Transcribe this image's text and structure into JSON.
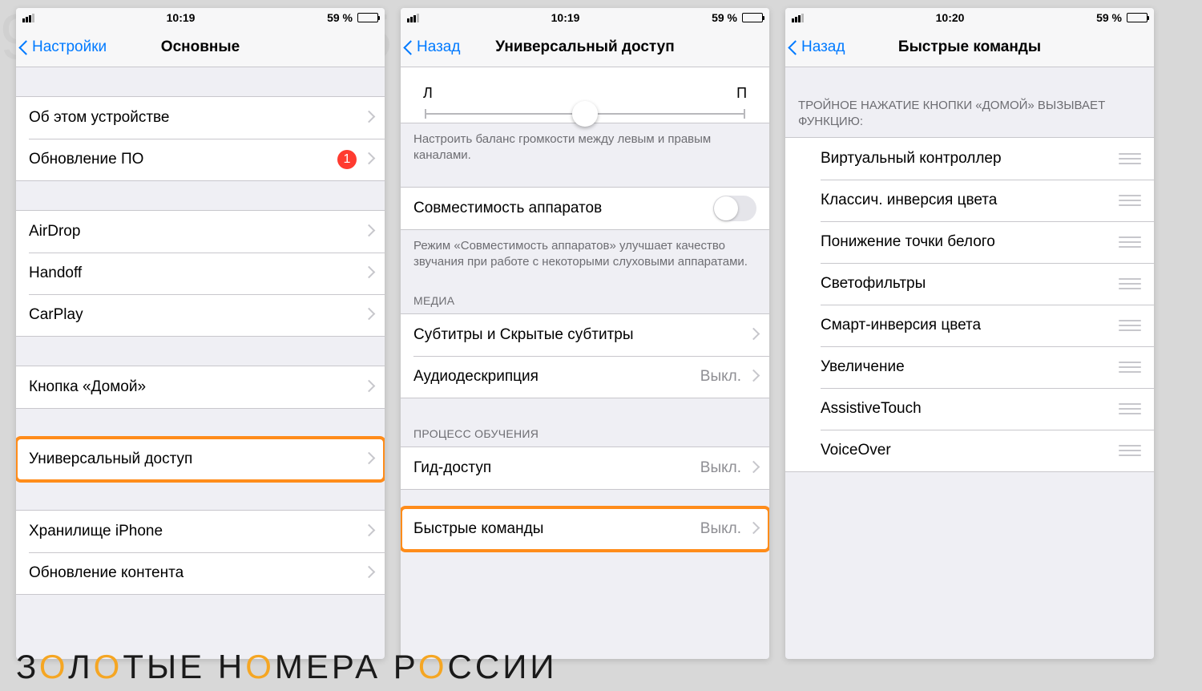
{
  "status": {
    "battery": "59 %"
  },
  "screen1": {
    "time": "10:19",
    "back": "Настройки",
    "title": "Основные",
    "g1": {
      "about": "Об этом устройстве",
      "update": "Обновление ПО",
      "badge": "1"
    },
    "g2": {
      "airdrop": "AirDrop",
      "handoff": "Handoff",
      "carplay": "CarPlay"
    },
    "g3": {
      "home": "Кнопка «Домой»"
    },
    "g4": {
      "access": "Универсальный доступ"
    },
    "g5": {
      "storage": "Хранилище iPhone",
      "refresh": "Обновление контента"
    }
  },
  "screen2": {
    "time": "10:19",
    "back": "Назад",
    "title": "Универсальный доступ",
    "slider": {
      "left": "Л",
      "right": "П"
    },
    "slider_footer": "Настроить баланс громкости между левым и правым каналами.",
    "compat": "Совместимость аппаратов",
    "compat_footer": "Режим «Совместимость аппаратов» улучшает качество звучания при работе с некоторыми слуховыми аппаратами.",
    "media_header": "МЕДИА",
    "subtitles": "Субтитры и Скрытые субтитры",
    "audiodesc": "Аудиодескрипция",
    "audiodesc_val": "Выкл.",
    "learn_header": "ПРОЦЕСС ОБУЧЕНИЯ",
    "guided": "Гид-доступ",
    "guided_val": "Выкл.",
    "shortcuts": "Быстрые команды",
    "shortcuts_val": "Выкл."
  },
  "screen3": {
    "time": "10:20",
    "back": "Назад",
    "title": "Быстрые команды",
    "header": "ТРОЙНОЕ НАЖАТИЕ КНОПКИ «ДОМОЙ» ВЫЗЫВАЕТ ФУНКЦИЮ:",
    "items": [
      "Виртуальный контроллер",
      "Классич. инверсия цвета",
      "Понижение точки белого",
      "Светофильтры",
      "Смарт-инверсия цвета",
      "Увеличение",
      "AssistiveTouch",
      "VoiceOver"
    ]
  },
  "watermark": {
    "t1": "З",
    "t2": "Л",
    "t3": "ТЫЕ Н",
    "t4": "МЕРА Р",
    "t5": "ССИИ"
  }
}
